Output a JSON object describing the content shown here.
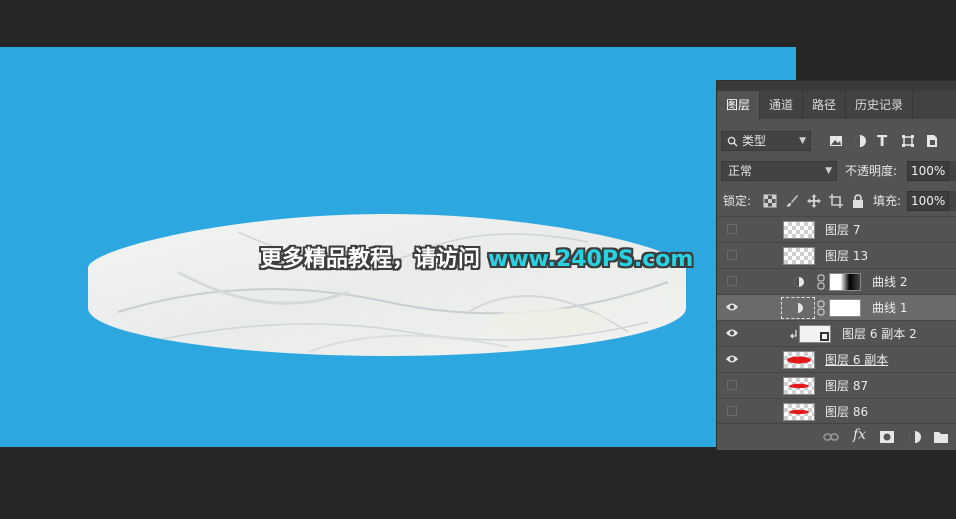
{
  "canvas": {
    "background": "#2ca7e0",
    "watermark": {
      "chinese": "更多精品教程，请访问",
      "url": "www.240PS.com"
    }
  },
  "layers_panel": {
    "tabs": [
      {
        "label": "图层",
        "active": true
      },
      {
        "label": "通道",
        "active": false
      },
      {
        "label": "路径",
        "active": false
      },
      {
        "label": "历史记录",
        "active": false
      }
    ],
    "filter_kind": "类型",
    "blend_mode": "正常",
    "opacity_label": "不透明度:",
    "opacity_value": "100%",
    "lock_label": "锁定:",
    "fill_label": "填充:",
    "fill_value": "100%",
    "layers": [
      {
        "name": "图层 7",
        "visible": false,
        "kind": "pixel",
        "selected": false
      },
      {
        "name": "图层 13",
        "visible": false,
        "kind": "pixel",
        "selected": false
      },
      {
        "name": "曲线 2",
        "visible": false,
        "kind": "curves-gradient",
        "selected": false
      },
      {
        "name": "曲线 1",
        "visible": true,
        "kind": "curves-white",
        "selected": true
      },
      {
        "name": "图层 6 副本 2",
        "visible": true,
        "kind": "smart-clipped",
        "selected": false
      },
      {
        "name": "图层 6 副本",
        "visible": true,
        "kind": "red",
        "selected": false
      },
      {
        "name": "图层 87",
        "visible": false,
        "kind": "red",
        "selected": false
      },
      {
        "name": "图层 86",
        "visible": false,
        "kind": "red",
        "selected": false
      }
    ],
    "icons": {
      "filter": "search-icon",
      "bottom": [
        "link-icon",
        "fx-icon",
        "mask-icon",
        "adjustment-icon",
        "folder-icon"
      ]
    }
  }
}
